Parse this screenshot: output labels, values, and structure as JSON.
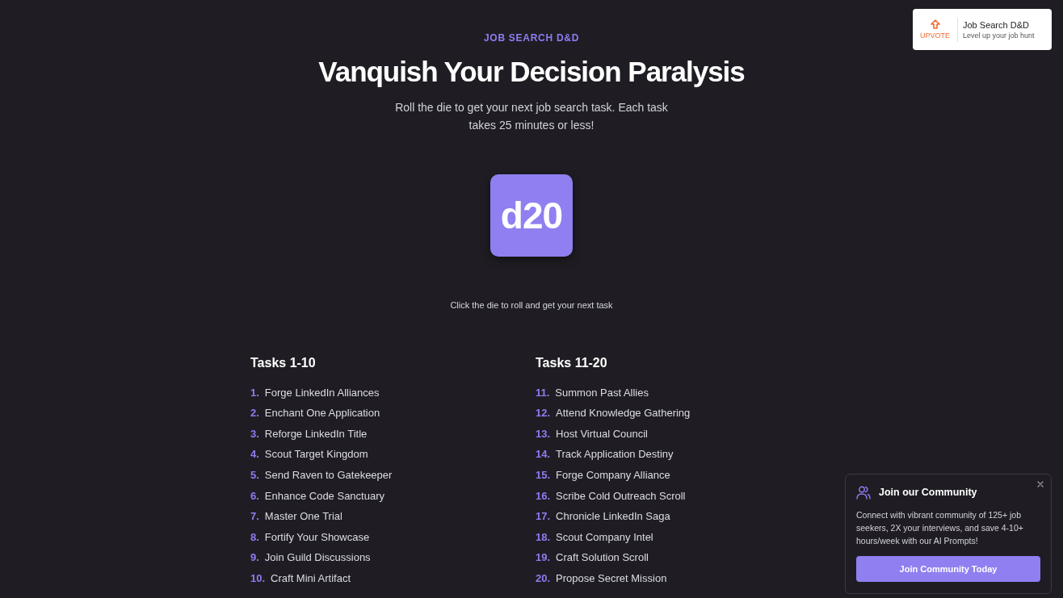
{
  "header": {
    "eyebrow": "JOB SEARCH D&D",
    "title": "Vanquish Your Decision Paralysis",
    "subtitle": "Roll the die to get your next job search task. Each task takes 25 minutes or less!"
  },
  "upvote_badge": {
    "action": "UPVOTE",
    "name": "Job Search D&D",
    "tagline": "Level up your job hunt"
  },
  "die": {
    "label": "d20",
    "hint": "Click the die to roll and get your next task"
  },
  "task_lists": [
    {
      "heading": "Tasks 1-10",
      "items": [
        {
          "number": "1.",
          "label": "Forge LinkedIn Alliances"
        },
        {
          "number": "2.",
          "label": "Enchant One Application"
        },
        {
          "number": "3.",
          "label": "Reforge LinkedIn Title"
        },
        {
          "number": "4.",
          "label": "Scout Target Kingdom"
        },
        {
          "number": "5.",
          "label": "Send Raven to Gatekeeper"
        },
        {
          "number": "6.",
          "label": "Enhance Code Sanctuary"
        },
        {
          "number": "7.",
          "label": "Master One Trial"
        },
        {
          "number": "8.",
          "label": "Fortify Your Showcase"
        },
        {
          "number": "9.",
          "label": "Join Guild Discussions"
        },
        {
          "number": "10.",
          "label": "Craft Mini Artifact"
        }
      ]
    },
    {
      "heading": "Tasks 11-20",
      "items": [
        {
          "number": "11.",
          "label": "Summon Past Allies"
        },
        {
          "number": "12.",
          "label": "Attend Knowledge Gathering"
        },
        {
          "number": "13.",
          "label": "Host Virtual Council"
        },
        {
          "number": "14.",
          "label": "Track Application Destiny"
        },
        {
          "number": "15.",
          "label": "Forge Company Alliance"
        },
        {
          "number": "16.",
          "label": "Scribe Cold Outreach Scroll"
        },
        {
          "number": "17.",
          "label": "Chronicle LinkedIn Saga"
        },
        {
          "number": "18.",
          "label": "Scout Company Intel"
        },
        {
          "number": "19.",
          "label": "Craft Solution Scroll"
        },
        {
          "number": "20.",
          "label": "Propose Secret Mission"
        }
      ]
    }
  ],
  "community_popup": {
    "title": "Join our Community",
    "body": "Connect with vibrant community of 125+ job seekers, 2X your interviews, and save 4-10+ hours/week with our AI Prompts!",
    "button": "Join Community Today"
  }
}
